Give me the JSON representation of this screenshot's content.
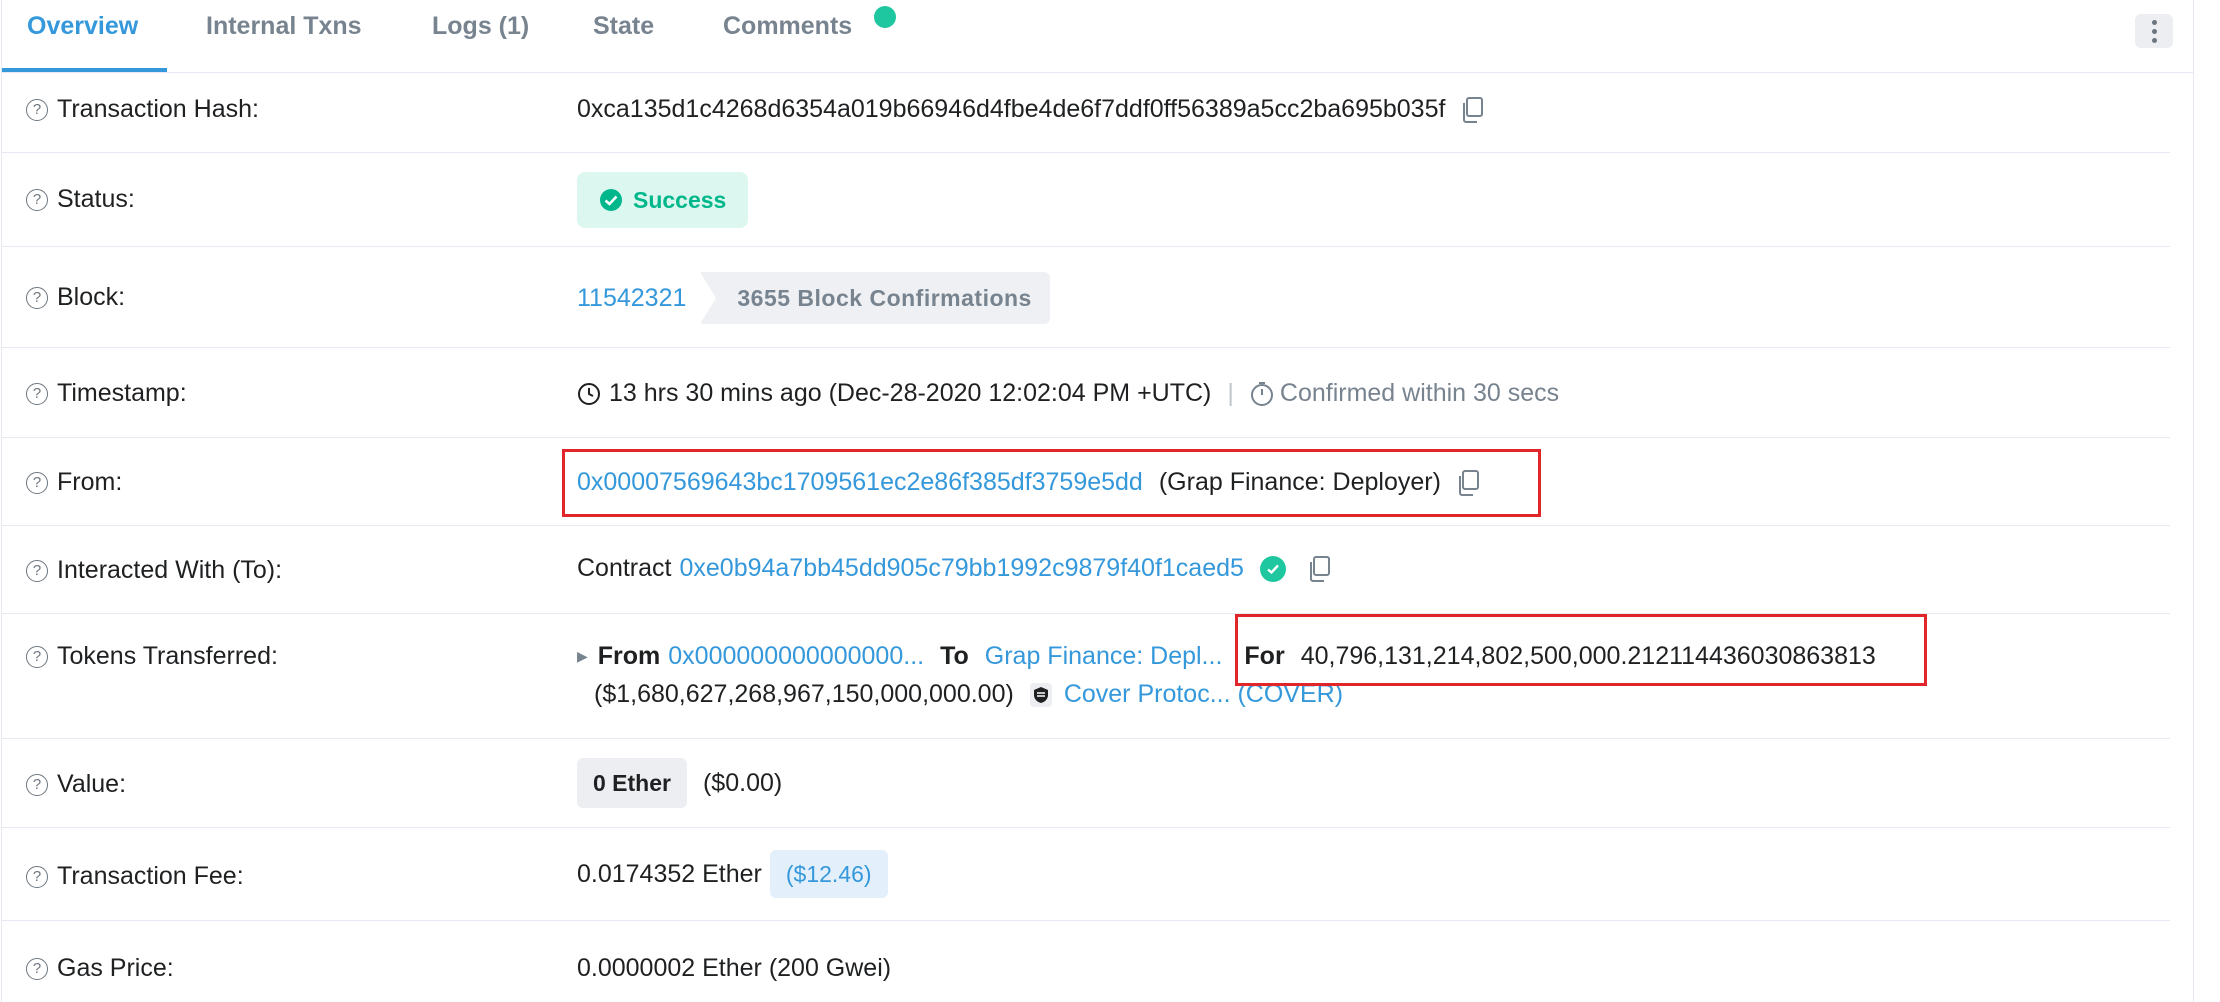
{
  "tabs": [
    {
      "label": "Overview",
      "active": true
    },
    {
      "label": "Internal Txns"
    },
    {
      "label": "Logs (1)"
    },
    {
      "label": "State"
    },
    {
      "label": "Comments"
    }
  ],
  "fields": {
    "tx_hash": {
      "label": "Transaction Hash:",
      "value": "0xca135d1c4268d6354a019b66946d4fbe4de6f7ddf0ff56389a5cc2ba695b035f"
    },
    "status": {
      "label": "Status:",
      "value": "Success"
    },
    "block": {
      "label": "Block:",
      "number": "11542321",
      "confirmations": "3655 Block Confirmations"
    },
    "timestamp": {
      "label": "Timestamp:",
      "value": "13 hrs 30 mins ago (Dec-28-2020 12:02:04 PM +UTC)",
      "confirmed": "Confirmed within 30 secs"
    },
    "from": {
      "label": "From:",
      "address": "0x00007569643bc1709561ec2e86f385df3759e5dd",
      "name": "(Grap Finance: Deployer)"
    },
    "to": {
      "label": "Interacted With (To):",
      "prefix": "Contract",
      "address": "0xe0b94a7bb45dd905c79bb1992c9879f40f1caed5"
    },
    "tokens": {
      "label": "Tokens Transferred:",
      "from_label": "From",
      "from_addr": "0x000000000000000...",
      "to_label": "To",
      "to_name": "Grap Finance: Depl...",
      "for_label": "For",
      "amount": "40,796,131,214,802,500,000.212114436030863813",
      "usd": "($1,680,627,268,967,150,000,000.00)",
      "token": "Cover Protoc... (COVER)"
    },
    "value": {
      "label": "Value:",
      "ether": "0 Ether",
      "usd": "($0.00)"
    },
    "fee": {
      "label": "Transaction Fee:",
      "value": "0.0174352 Ether",
      "usd": "($12.46)"
    },
    "gas": {
      "label": "Gas Price:",
      "value": "0.0000002 Ether (200 Gwei)"
    }
  },
  "colors": {
    "link": "#3498db",
    "success": "#00b78b",
    "highlight": "#e0262a"
  }
}
